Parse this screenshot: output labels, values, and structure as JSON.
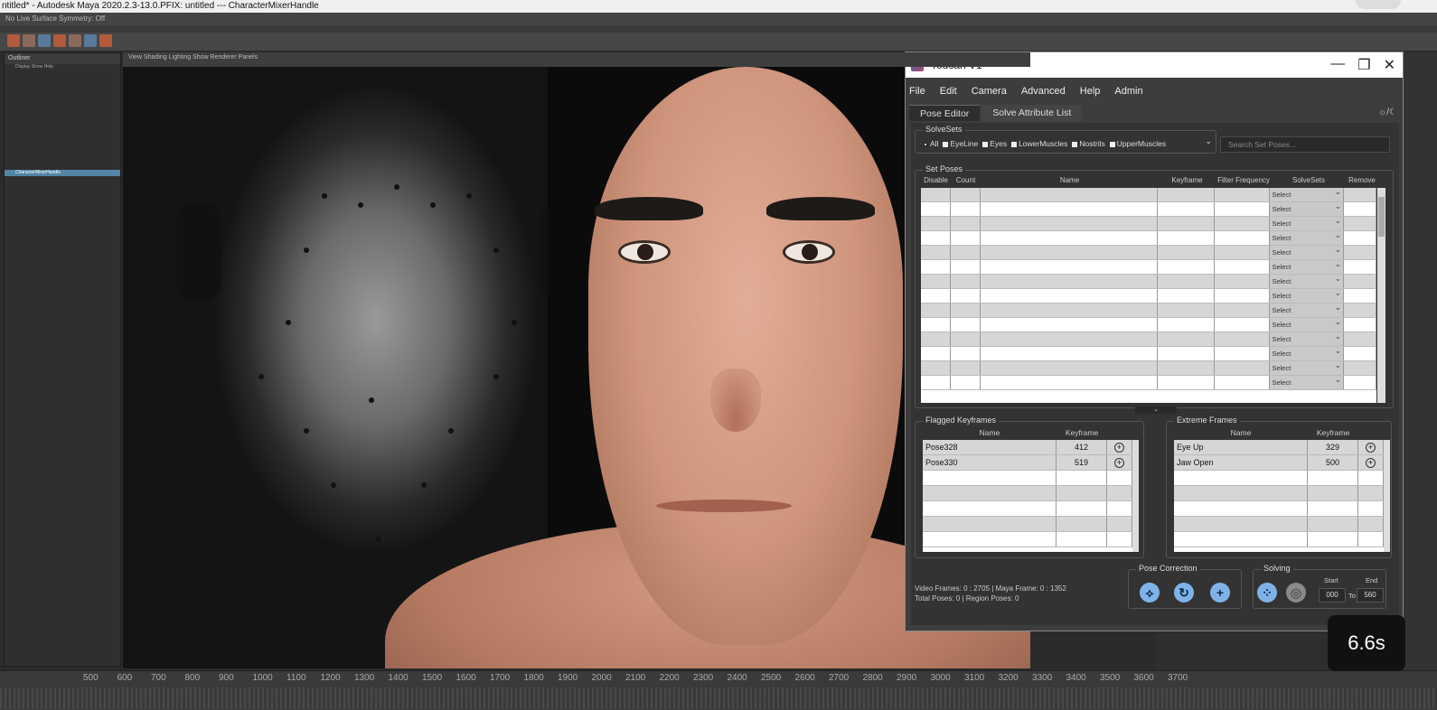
{
  "maya": {
    "window_title": "ntitled* - Autodesk Maya 2020.2.3-13.0.PFIX: untitled   ---   CharacterMixerHandle",
    "toolbar_row": "No Live Surface     Symmetry: Off",
    "outliner": {
      "title": "Outliner",
      "menu": "Display   Show   Help",
      "selected_item": "CharacterMixerHandle"
    },
    "viewport_menu": "View  Shading  Lighting  Show  Renderer  Panels",
    "timeline_ticks": [
      "500",
      "600",
      "700",
      "800",
      "900",
      "1000",
      "1100",
      "1200",
      "1300",
      "1400",
      "1500",
      "1600",
      "1700",
      "1800",
      "1900",
      "2000",
      "2100",
      "2200",
      "2300",
      "2400",
      "2500",
      "2600",
      "2700",
      "2800",
      "2900",
      "3000",
      "3100",
      "3200",
      "3300",
      "3400",
      "3500",
      "3600",
      "3700"
    ]
  },
  "toucan": {
    "title": "Toucan V1",
    "menus": [
      "File",
      "Edit",
      "Camera",
      "Advanced",
      "Help",
      "Admin"
    ],
    "tabs": [
      "Pose Editor",
      "Solve Attribute List"
    ],
    "active_tab": "Pose Editor",
    "solvesets": {
      "legend": "SolveSets",
      "options": [
        "All",
        "EyeLine",
        "Eyes",
        "LowerMuscles",
        "Nostrils",
        "UpperMuscles"
      ]
    },
    "search_placeholder": "Search Set Poses...",
    "set_poses": {
      "legend": "Set Poses",
      "columns": [
        "Disable",
        "Count",
        "Name",
        "Keyframe",
        "Filter Frequency",
        "SolveSets",
        "Remove"
      ],
      "select_label": "Select",
      "row_count": 14
    },
    "flagged_keyframes": {
      "legend": "Flagged Keyframes",
      "columns": [
        "Name",
        "Keyframe"
      ],
      "rows": [
        {
          "name": "Pose328",
          "keyframe": "412"
        },
        {
          "name": "Pose330",
          "keyframe": "519"
        }
      ]
    },
    "extreme_frames": {
      "legend": "Extreme Frames",
      "columns": [
        "Name",
        "Keyframe"
      ],
      "rows": [
        {
          "name": "Eye Up",
          "keyframe": "329"
        },
        {
          "name": "Jaw Open",
          "keyframe": "500"
        }
      ]
    },
    "footer": {
      "line1": "Video Frames:  0 : 2705  |  Maya Frame:  0 : 1352",
      "line2": "Total Poses:  0  |  Region Poses: 0"
    },
    "pose_correction": {
      "legend": "Pose Correction"
    },
    "solving": {
      "legend": "Solving",
      "start_label": "Start",
      "end_label": "End",
      "start_value": "000",
      "to_label": "To",
      "end_value": "560"
    }
  },
  "overlay_timer": "6.6s",
  "colors": {
    "accent_blue": "#7fb3e8",
    "selection": "#5285a6"
  }
}
